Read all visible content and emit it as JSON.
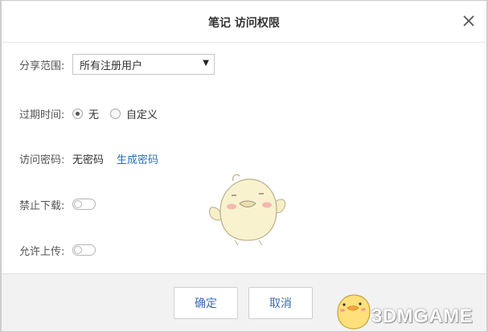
{
  "dialog": {
    "title": "笔记 访问权限",
    "close_icon": "close-icon"
  },
  "share_scope": {
    "label": "分享范围:",
    "selected": "所有注册用户"
  },
  "expire": {
    "label": "过期时间:",
    "options": [
      {
        "label": "无",
        "selected": true
      },
      {
        "label": "自定义",
        "selected": false
      }
    ]
  },
  "password": {
    "label": "访问密码:",
    "value": "无密码",
    "generate_link": "生成密码"
  },
  "disable_download": {
    "label": "禁止下载:",
    "enabled": false
  },
  "allow_upload": {
    "label": "允许上传:",
    "enabled": false
  },
  "footer": {
    "confirm_label": "确定",
    "cancel_label": "取消"
  },
  "watermark": {
    "text": "3DMGAME"
  }
}
